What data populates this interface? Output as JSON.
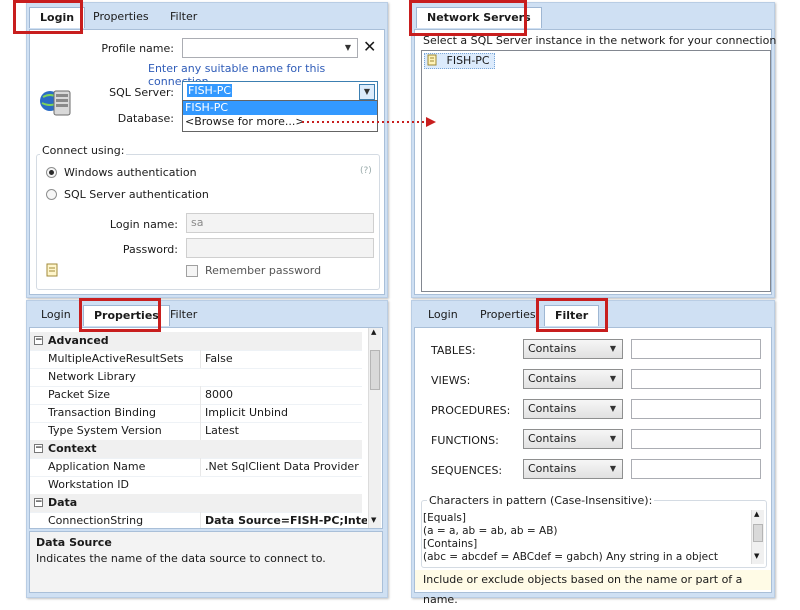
{
  "login_panel": {
    "tabs": [
      "Login",
      "Properties",
      "Filter"
    ],
    "profile_name_label": "Profile name:",
    "profile_hint": "Enter any suitable name for this connection.",
    "sql_server_label": "SQL Server:",
    "sql_server_value": "FISH-PC",
    "dropdown_options": [
      "FISH-PC",
      "<Browse for more...>"
    ],
    "database_label": "Database:",
    "connect_using_label": "Connect using:",
    "auth_windows": "Windows authentication",
    "auth_sql": "SQL Server authentication",
    "help_glyph": "(?)",
    "login_name_label": "Login name:",
    "login_name_value": "sa",
    "password_label": "Password:",
    "remember_password": "Remember password"
  },
  "network_panel": {
    "tab": "Network Servers",
    "instruction": "Select a SQL Server instance in the network for your connection",
    "servers": [
      "FISH-PC"
    ]
  },
  "properties_panel": {
    "tabs": [
      "Login",
      "Properties",
      "Filter"
    ],
    "rows": [
      {
        "kind": "cat",
        "name": "Advanced"
      },
      {
        "kind": "prop",
        "name": "MultipleActiveResultSets",
        "value": "False"
      },
      {
        "kind": "prop",
        "name": "Network Library",
        "value": ""
      },
      {
        "kind": "prop",
        "name": "Packet Size",
        "value": "8000"
      },
      {
        "kind": "prop",
        "name": "Transaction Binding",
        "value": "Implicit Unbind"
      },
      {
        "kind": "prop",
        "name": "Type System Version",
        "value": "Latest"
      },
      {
        "kind": "cat",
        "name": "Context"
      },
      {
        "kind": "prop",
        "name": "Application Name",
        "value": ".Net SqlClient Data Provider"
      },
      {
        "kind": "prop",
        "name": "Workstation ID",
        "value": ""
      },
      {
        "kind": "cat",
        "name": "Data"
      },
      {
        "kind": "prop",
        "name": "ConnectionString",
        "value": "Data Source=FISH-PC;Integrate"
      }
    ],
    "desc_title": "Data Source",
    "desc_text": "Indicates the name of the data source to connect to."
  },
  "filter_panel": {
    "tabs": [
      "Login",
      "Properties",
      "Filter"
    ],
    "rows": [
      {
        "label": "TABLES:",
        "op": "Contains"
      },
      {
        "label": "VIEWS:",
        "op": "Contains"
      },
      {
        "label": "PROCEDURES:",
        "op": "Contains"
      },
      {
        "label": "FUNCTIONS:",
        "op": "Contains"
      },
      {
        "label": "SEQUENCES:",
        "op": "Contains"
      }
    ],
    "pattern_title": "Characters in pattern (Case-Insensitive):",
    "pattern_lines": [
      "[Equals]",
      "(a = a, ab = ab, ab = AB)",
      "[Contains]",
      "(abc = abcdef = ABCdef = gabch) Any string in a object"
    ],
    "footer": "Include or exclude objects based on the name or part of a name."
  },
  "colors": {
    "highlight": "#c81e1e",
    "panel": "#cfe0f3",
    "selection": "#3399ff"
  }
}
